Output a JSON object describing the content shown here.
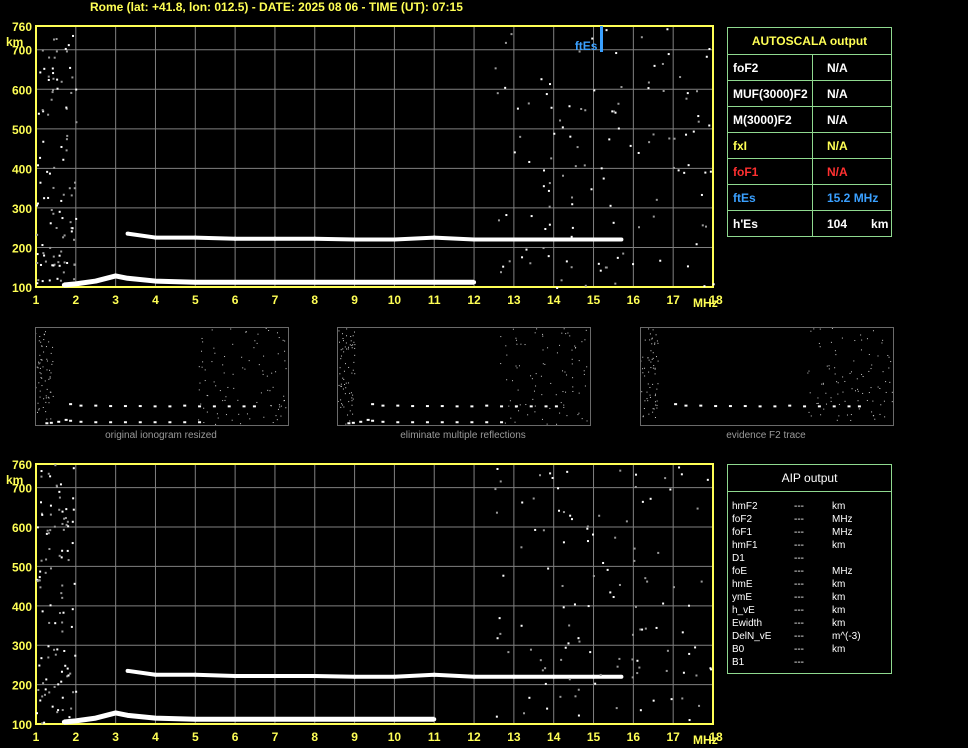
{
  "header": {
    "text": "Rome (lat: +41.8, lon: 012.5) - DATE: 2025 08 06 - TIME (UT): 07:15"
  },
  "colors": {
    "frame": "#ffff55",
    "grid": "#808080",
    "panel_border": "#8fd98f",
    "fo_red": "#ff3030",
    "fte_blue": "#3aa0ff"
  },
  "autoscala": {
    "title": "AUTOSCALA output",
    "rows": [
      {
        "key": "foF2",
        "value": "N/A",
        "unit": "",
        "color": "#ffffff"
      },
      {
        "key": "MUF(3000)F2",
        "value": "N/A",
        "unit": "",
        "color": "#ffffff"
      },
      {
        "key": "M(3000)F2",
        "value": "N/A",
        "unit": "",
        "color": "#ffffff"
      },
      {
        "key": "fxI",
        "value": "N/A",
        "unit": "",
        "color": "#ffff55"
      },
      {
        "key": "foF1",
        "value": "N/A",
        "unit": "",
        "color": "#ff3030"
      },
      {
        "key": "ftEs",
        "value": "15.2 MHz",
        "unit": "",
        "color": "#3aa0ff"
      },
      {
        "key": "h'Es",
        "value": "104",
        "unit": "km",
        "color": "#ffffff"
      }
    ]
  },
  "aip": {
    "title": "AIP output",
    "rows": [
      {
        "key": "hmF2",
        "value": "---",
        "unit": "km"
      },
      {
        "key": "foF2",
        "value": "---",
        "unit": "MHz"
      },
      {
        "key": "foF1",
        "value": "---",
        "unit": "MHz"
      },
      {
        "key": "hmF1",
        "value": "---",
        "unit": "km"
      },
      {
        "key": "D1",
        "value": "---",
        "unit": ""
      },
      {
        "key": "foE",
        "value": "---",
        "unit": "MHz"
      },
      {
        "key": "hmE",
        "value": "---",
        "unit": "km"
      },
      {
        "key": "ymE",
        "value": "---",
        "unit": "km"
      },
      {
        "key": "h_vE",
        "value": "---",
        "unit": "km"
      },
      {
        "key": "Ewidth",
        "value": "---",
        "unit": "km"
      },
      {
        "key": "DelN_vE",
        "value": "---",
        "unit": "m^(-3)"
      },
      {
        "key": "B0",
        "value": "---",
        "unit": "km"
      },
      {
        "key": "B1",
        "value": "---",
        "unit": ""
      }
    ]
  },
  "captions": [
    "original ionogram resized",
    "eliminate multiple reflections",
    "evidence F2 trace"
  ],
  "chart_data": [
    {
      "type": "scatter",
      "xlabel": "MHz",
      "ylabel": "km",
      "xlim": [
        1,
        18
      ],
      "ylim": [
        100,
        760
      ],
      "xticks": [
        1,
        2,
        3,
        4,
        5,
        6,
        7,
        8,
        9,
        10,
        11,
        12,
        13,
        14,
        15,
        16,
        17,
        18
      ],
      "yticks": [
        100,
        200,
        300,
        400,
        500,
        600,
        700,
        760
      ],
      "grid": true,
      "annotation": {
        "text": "ftEs",
        "x": 15.2
      },
      "series": [
        {
          "values": [
            [
              1.7,
              105
            ],
            [
              2,
              108
            ],
            [
              2.5,
              115
            ],
            [
              3,
              128
            ],
            [
              3.3,
              122
            ],
            [
              4,
              115
            ],
            [
              5,
              112
            ],
            [
              6,
              112
            ],
            [
              7,
              112
            ],
            [
              8,
              112
            ],
            [
              9,
              112
            ],
            [
              10,
              112
            ],
            [
              11,
              112
            ],
            [
              12,
              112
            ]
          ]
        },
        {
          "values": [
            [
              3.3,
              235
            ],
            [
              4,
              225
            ],
            [
              5,
              225
            ],
            [
              6,
              222
            ],
            [
              7,
              222
            ],
            [
              8,
              222
            ],
            [
              9,
              220
            ],
            [
              10,
              220
            ],
            [
              11,
              225
            ],
            [
              12,
              220
            ],
            [
              13,
              220
            ],
            [
              14,
              220
            ],
            [
              15,
              220
            ],
            [
              15.7,
              220
            ]
          ]
        }
      ]
    },
    {
      "type": "scatter",
      "xlabel": "MHz",
      "ylabel": "km",
      "xlim": [
        1,
        18
      ],
      "ylim": [
        100,
        760
      ],
      "xticks": [
        1,
        2,
        3,
        4,
        5,
        6,
        7,
        8,
        9,
        10,
        11,
        12,
        13,
        14,
        15,
        16,
        17,
        18
      ],
      "yticks": [
        100,
        200,
        300,
        400,
        500,
        600,
        700,
        760
      ],
      "grid": true,
      "series": [
        {
          "values": [
            [
              1.7,
              105
            ],
            [
              2,
              108
            ],
            [
              2.5,
              115
            ],
            [
              3,
              128
            ],
            [
              3.3,
              122
            ],
            [
              4,
              115
            ],
            [
              5,
              112
            ],
            [
              6,
              112
            ],
            [
              7,
              112
            ],
            [
              8,
              112
            ],
            [
              9,
              112
            ],
            [
              10,
              112
            ],
            [
              11,
              112
            ]
          ]
        },
        {
          "values": [
            [
              3.3,
              235
            ],
            [
              4,
              225
            ],
            [
              5,
              225
            ],
            [
              6,
              222
            ],
            [
              7,
              222
            ],
            [
              8,
              222
            ],
            [
              9,
              220
            ],
            [
              10,
              220
            ],
            [
              11,
              225
            ],
            [
              12,
              220
            ],
            [
              13,
              220
            ],
            [
              14,
              220
            ],
            [
              15,
              220
            ],
            [
              15.7,
              220
            ]
          ]
        }
      ]
    }
  ]
}
